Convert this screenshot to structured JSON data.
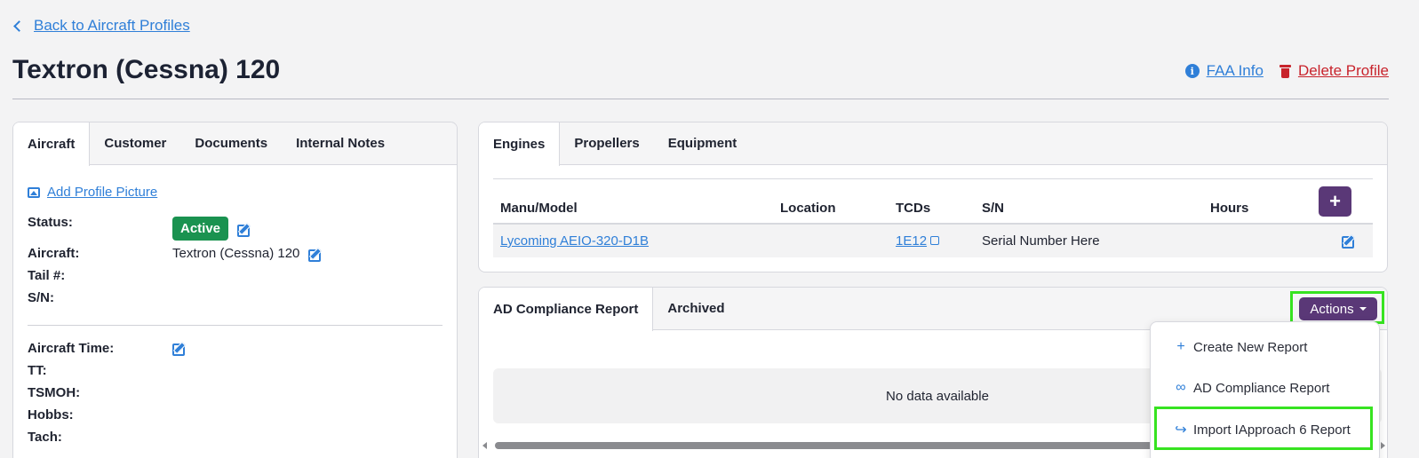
{
  "header": {
    "back_label": "Back to Aircraft Profiles",
    "title": "Textron (Cessna) 120",
    "faa_info": "FAA Info",
    "delete_profile": "Delete Profile"
  },
  "left_tabs": [
    "Aircraft",
    "Customer",
    "Documents",
    "Internal Notes"
  ],
  "aircraft": {
    "add_picture": "Add Profile Picture",
    "status_label": "Status:",
    "status_value": "Active",
    "aircraft_label": "Aircraft:",
    "aircraft_value": "Textron (Cessna) 120",
    "tail_label": "Tail #:",
    "sn_label": "S/N:",
    "time_label": "Aircraft Time:",
    "tt_label": "TT:",
    "tsmoh_label": "TSMOH:",
    "hobbs_label": "Hobbs:",
    "tach_label": "Tach:"
  },
  "engine_tabs": [
    "Engines",
    "Propellers",
    "Equipment"
  ],
  "engines": {
    "columns": [
      "Manu/Model",
      "Location",
      "TCDs",
      "S/N",
      "Hours"
    ],
    "rows": [
      {
        "model": "Lycoming AEIO-320-D1B",
        "location": "",
        "tcds": "1E12",
        "sn": "Serial Number Here",
        "hours": ""
      }
    ],
    "add_symbol": "+"
  },
  "ad_tabs": [
    "AD Compliance Report",
    "Archived"
  ],
  "ad": {
    "actions_label": "Actions",
    "no_data": "No data available"
  },
  "actions_menu": [
    {
      "label": "Create New Report",
      "icon": "plus-icon"
    },
    {
      "label": "AD Compliance Report",
      "icon": "link-icon"
    },
    {
      "label": "Import IApproach 6 Report",
      "icon": "file-import-icon"
    }
  ],
  "colors": {
    "accent": "#5a3877",
    "link": "#2f7fd8",
    "danger": "#c8232c",
    "success": "#1a9250",
    "highlight": "#37e321"
  }
}
